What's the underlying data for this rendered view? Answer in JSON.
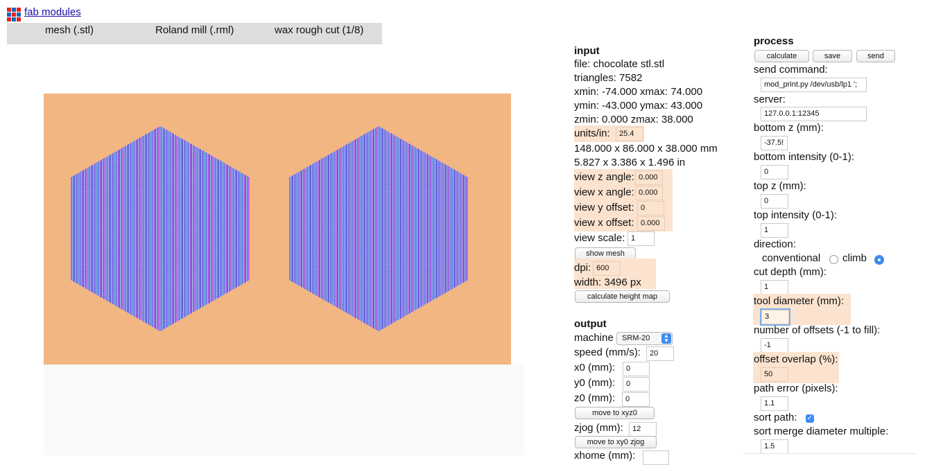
{
  "header": {
    "logo_icon": "grid-logo-icon",
    "logo_colors": [
      "#e8231b",
      "#1565c0",
      "#e8231b",
      "#1565c0",
      "#e8231b",
      "#1565c0",
      "#e8231b",
      "#1565c0",
      "#e8231b"
    ],
    "title": "fab modules"
  },
  "tabs": [
    {
      "label": "mesh (.stl)"
    },
    {
      "label": "Roland mill (.rml)"
    },
    {
      "label": "wax rough cut (1/8)"
    }
  ],
  "viewer": {
    "background_color": "#f1b681"
  },
  "input": {
    "heading": "input",
    "file": "file: chocolate stl.stl",
    "triangles": "triangles: 7582",
    "x_range": "xmin: -74.000 xmax: 74.000",
    "y_range": "ymin: -43.000 ymax: 43.000",
    "z_range": "zmin: 0.000 zmax: 38.000",
    "units_label": "units/in:",
    "units_value": "25.4",
    "size_mm": "148.000 x 86.000 x 38.000 mm",
    "size_in": "5.827 x 3.386 x 1.496 in",
    "view_z_angle_label": "view z angle:",
    "view_z_angle_value": "0.000",
    "view_x_angle_label": "view x angle:",
    "view_x_angle_value": "0.000",
    "view_y_offset_label": "view y offset:",
    "view_y_offset_value": "0",
    "view_x_offset_label": "view x offset:",
    "view_x_offset_value": "0.000",
    "view_scale_label": "view scale:",
    "view_scale_value": "1",
    "show_mesh_button": "show mesh",
    "dpi_label": "dpi:",
    "dpi_value": "600",
    "width": "width: 3496 px",
    "calc_height_map_button": "calculate height map"
  },
  "output": {
    "heading": "output",
    "machine_label": "machine",
    "machine_value": "SRM-20",
    "speed_label": "speed (mm/s):",
    "speed_value": "20",
    "x0_label": "x0 (mm):",
    "x0_value": "0",
    "y0_label": "y0 (mm):",
    "y0_value": "0",
    "z0_label": "z0 (mm):",
    "z0_value": "0",
    "move_xyz0_button": "move to xyz0",
    "zjog_label": "zjog (mm):",
    "zjog_value": "12",
    "move_xy0_zjog_button": "move to xy0 zjog",
    "xhome_label": "xhome (mm):"
  },
  "process": {
    "heading": "process",
    "calculate_button": "calculate",
    "save_button": "save",
    "send_button": "send",
    "send_command_label": "send command:",
    "send_command_value": "mod_print.py /dev/usb/lp1 ';",
    "server_label": "server:",
    "server_value": "127.0.0.1:12345",
    "bottom_z_label": "bottom z (mm):",
    "bottom_z_value": "-37.5!",
    "bottom_intensity_label": "bottom intensity (0-1):",
    "bottom_intensity_value": "0",
    "top_z_label": "top z (mm):",
    "top_z_value": "0",
    "top_intensity_label": "top intensity (0-1):",
    "top_intensity_value": "1",
    "direction_label": "direction:",
    "conventional_label": "conventional",
    "climb_label": "climb",
    "direction_selected": "climb",
    "cut_depth_label": "cut depth (mm):",
    "cut_depth_value": "1",
    "tool_diameter_label": "tool diameter (mm):",
    "tool_diameter_value": "3",
    "offsets_label": "number of offsets (-1 to fill):",
    "offsets_value": "-1",
    "overlap_label": "offset overlap (%):",
    "overlap_value": "50",
    "path_error_label": "path error (pixels):",
    "path_error_value": "1.1",
    "sort_path_label": "sort path:",
    "sort_path_checked": true,
    "sort_merge_label": "sort merge diameter multiple:",
    "sort_merge_value": "1.5"
  }
}
